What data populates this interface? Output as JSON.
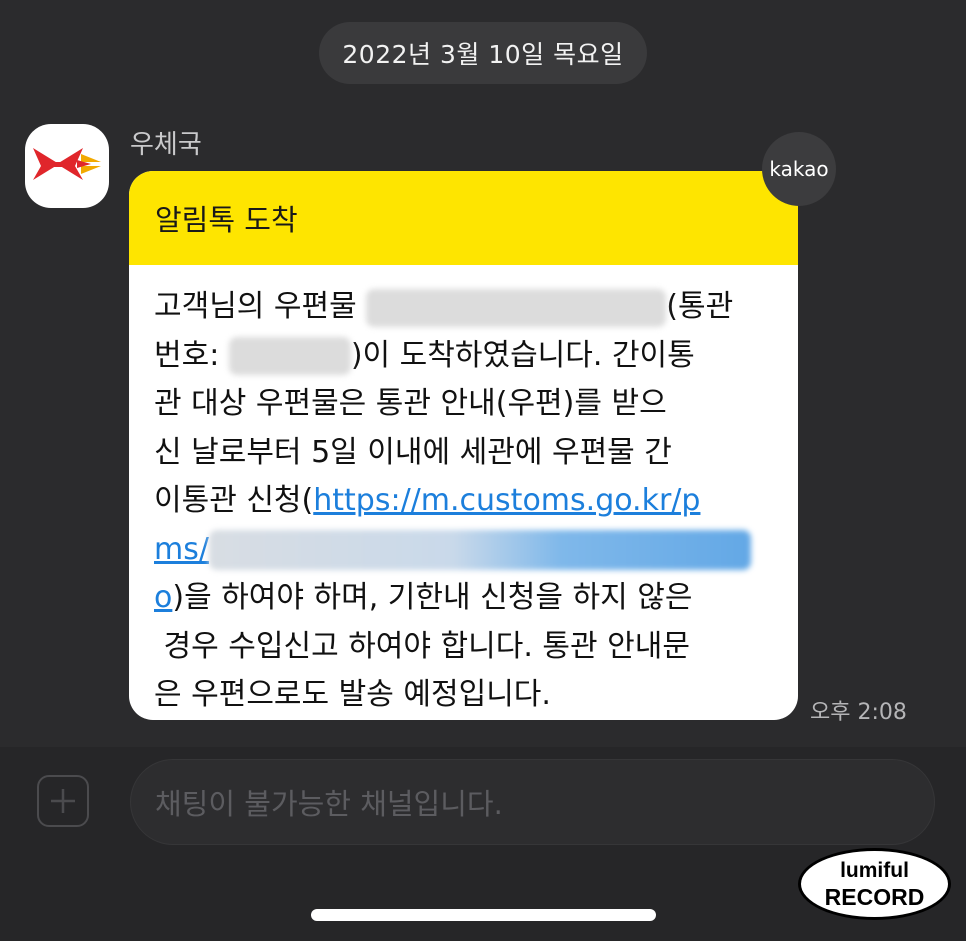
{
  "chat": {
    "date": "2022년 3월 10일 목요일",
    "sender": "우체국",
    "badge": "kakao"
  },
  "message": {
    "header": "알림톡 도착",
    "lines": [
      {
        "a": "고객님의 우편물 ",
        "b": "(통관"
      },
      {
        "a": "번호: ",
        "b": ")이 도착하였습니다. 간이통"
      },
      {
        "a": "관 대상 우편물은 통관 안내(우편)를 받으"
      },
      {
        "a": "신 날로부터 5일 이내에 세관에 우편물 간"
      },
      {
        "a": "이통관 신청(",
        "link": "https://m.customs.go.kr/p"
      },
      {
        "link": "ms/"
      },
      {
        "link": "o",
        "b": ")을 하여야 하며, 기한내 신청을 하지 않은"
      },
      {
        "a": " 경우 수입신고 하여야 합니다. 통관 안내문"
      },
      {
        "a": "은 우편으로도 발송 예정입니다."
      }
    ],
    "time": "오후 2:08"
  },
  "input": {
    "placeholder": "채팅이 불가능한 채널입니다."
  },
  "watermark": {
    "line1": "lumiful",
    "line2": "RECORD"
  },
  "colors": {
    "background": "#2b2b2d",
    "header_yellow": "#fee500",
    "link_blue": "#1c7fdc",
    "logo_red": "#e0262b"
  },
  "icons": {
    "avatar": "korea-post-logo-icon",
    "attach": "plus-icon"
  }
}
